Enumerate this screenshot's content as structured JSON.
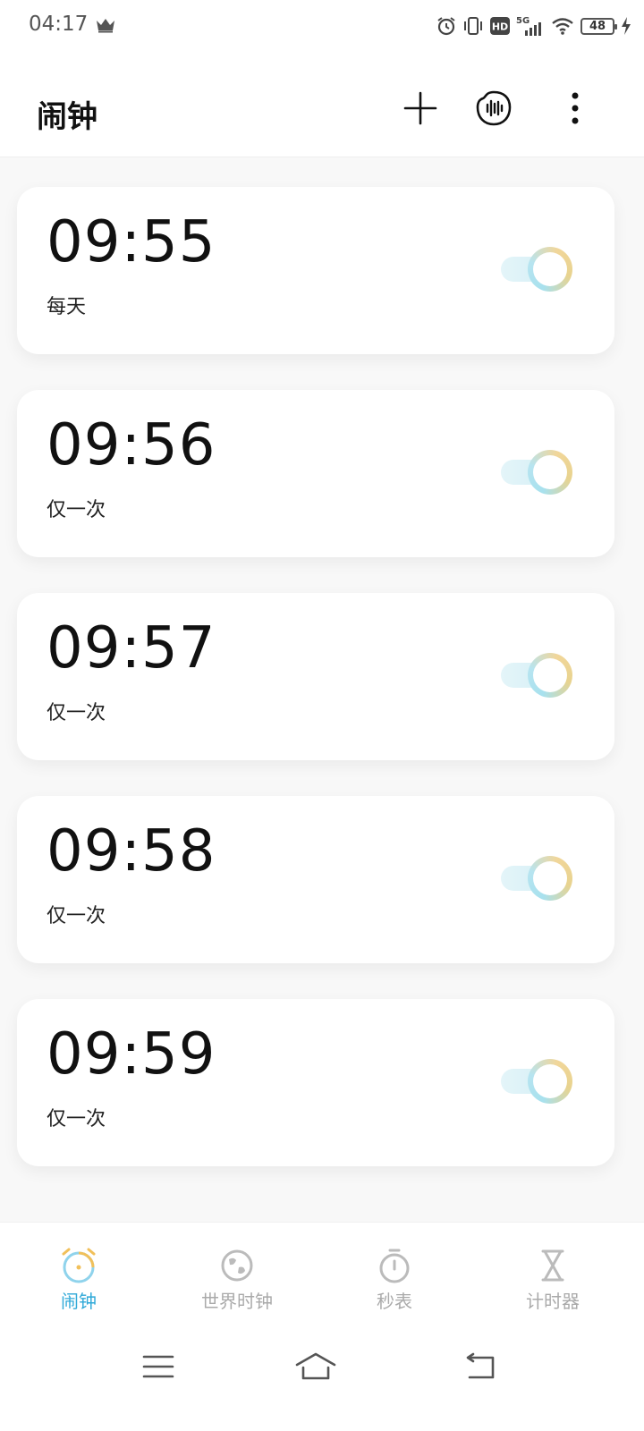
{
  "status_bar": {
    "time": "04:17",
    "network": "5G",
    "hd_label": "HD",
    "battery_level": "48",
    "icons": [
      "crown-icon",
      "alarm-icon",
      "vibrate-icon",
      "hd-icon",
      "signal-icon",
      "wifi-icon",
      "battery-icon",
      "charging-icon"
    ]
  },
  "app_bar": {
    "title": "闹钟",
    "actions": [
      "add-icon",
      "voice-icon",
      "more-icon"
    ]
  },
  "alarms": [
    {
      "time": "09:55",
      "repeat": "每天",
      "enabled": true
    },
    {
      "time": "09:56",
      "repeat": "仅一次",
      "enabled": true
    },
    {
      "time": "09:57",
      "repeat": "仅一次",
      "enabled": true
    },
    {
      "time": "09:58",
      "repeat": "仅一次",
      "enabled": true
    },
    {
      "time": "09:59",
      "repeat": "仅一次",
      "enabled": true
    }
  ],
  "bottom_nav": {
    "items": [
      {
        "label": "闹钟",
        "icon": "alarm-clock-icon",
        "active": true
      },
      {
        "label": "世界时钟",
        "icon": "globe-icon",
        "active": false
      },
      {
        "label": "秒表",
        "icon": "stopwatch-icon",
        "active": false
      },
      {
        "label": "计时器",
        "icon": "hourglass-icon",
        "active": false
      }
    ]
  },
  "colors": {
    "accent": "#2fa9d8",
    "toggle_gold": "#f1d69a",
    "toggle_blue": "#a8e1ee",
    "inactive_nav": "#aaaaaa"
  }
}
